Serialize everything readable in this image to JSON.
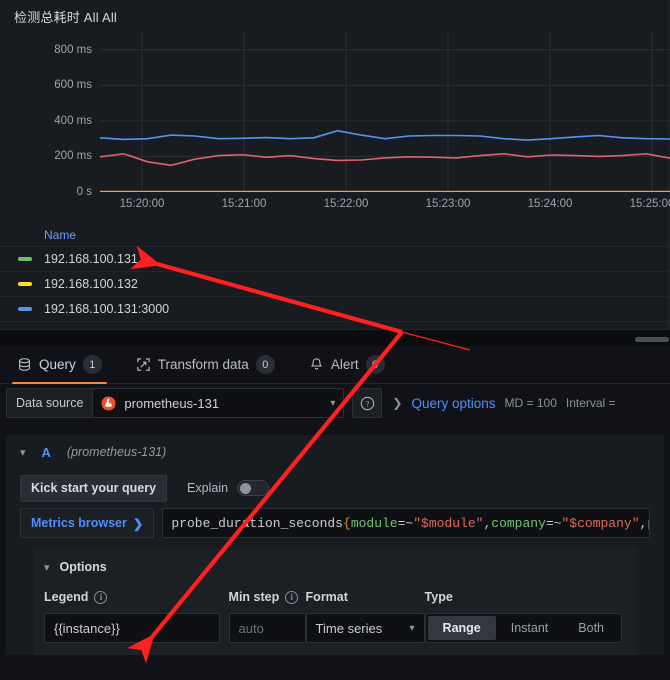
{
  "panel": {
    "title": "检测总耗时 All All",
    "legend_header": "Name",
    "legend": [
      {
        "label": "192.168.100.131",
        "color": "#73BF69"
      },
      {
        "label": "192.168.100.132",
        "color": "#FADE2A"
      },
      {
        "label": "192.168.100.131:3000",
        "color": "#5794F2"
      }
    ]
  },
  "chart_data": {
    "type": "line",
    "title": "检测总耗时 All All",
    "xlabel": "",
    "ylabel": "",
    "grid": true,
    "legend_position": "bottom-table",
    "ytick_labels": [
      "800 ms",
      "600 ms",
      "400 ms",
      "200 ms",
      "0 s"
    ],
    "ytick_values": [
      800,
      600,
      400,
      200,
      0
    ],
    "ylim": [
      0,
      900
    ],
    "xtick_labels": [
      "15:20:00",
      "15:21:00",
      "15:22:00",
      "15:23:00",
      "15:24:00",
      "15:25:00"
    ],
    "x": [
      "15:19:30",
      "15:19:45",
      "15:20:00",
      "15:20:15",
      "15:20:30",
      "15:20:45",
      "15:21:00",
      "15:21:15",
      "15:21:30",
      "15:21:45",
      "15:22:00",
      "15:22:15",
      "15:22:30",
      "15:22:45",
      "15:23:00",
      "15:23:15",
      "15:23:30",
      "15:23:45",
      "15:24:00",
      "15:24:15",
      "15:24:30",
      "15:24:45",
      "15:25:00",
      "15:25:15",
      "15:25:30"
    ],
    "series": [
      {
        "name": "192.168.100.131:3000",
        "color": "#5794F2",
        "unit": "ms",
        "values": [
          305,
          296,
          300,
          320,
          315,
          300,
          302,
          306,
          300,
          305,
          345,
          320,
          300,
          315,
          318,
          318,
          315,
          300,
          292,
          300,
          310,
          318,
          305,
          300,
          298
        ]
      },
      {
        "name": "192.168.100.131",
        "color": "#E0626E",
        "unit": "ms",
        "values": [
          198,
          215,
          170,
          150,
          185,
          205,
          210,
          195,
          205,
          188,
          178,
          180,
          192,
          198,
          196,
          192,
          205,
          215,
          198,
          208,
          205,
          200,
          205,
          215,
          190
        ]
      },
      {
        "name": "192.168.100.132",
        "color": "#FF9830",
        "unit": "ms",
        "values": [
          2,
          2,
          2,
          2,
          2,
          2,
          2,
          2,
          2,
          2,
          2,
          2,
          2,
          2,
          2,
          2,
          2,
          2,
          2,
          2,
          2,
          2,
          2,
          2,
          2
        ]
      }
    ]
  },
  "editor": {
    "tabs": [
      {
        "label": "Query",
        "count": "1",
        "icon": "database-icon",
        "active": true
      },
      {
        "label": "Transform data",
        "count": "0",
        "icon": "transform-icon",
        "active": false
      },
      {
        "label": "Alert",
        "count": "0",
        "icon": "bell-icon",
        "active": false
      }
    ],
    "datasource": {
      "label": "Data source",
      "value": "prometheus-131",
      "icon": "prometheus-icon"
    },
    "query_options": {
      "link": "Query options",
      "max_data_points": "MD = 100",
      "interval": "Interval ="
    },
    "query": {
      "ref_id": "A",
      "datasource_note": "(prometheus-131)",
      "kick_start_label": "Kick start your query",
      "explain_label": "Explain",
      "explain_on": false,
      "metrics_browser_label": "Metrics browser",
      "expr_tokens": [
        {
          "t": "probe_duration_seconds",
          "c": "tok-metric"
        },
        {
          "t": "{",
          "c": "tok-brace"
        },
        {
          "t": "module",
          "c": "tok-label"
        },
        {
          "t": "=~",
          "c": "tok-op"
        },
        {
          "t": "\"$module\"",
          "c": "tok-str"
        },
        {
          "t": ",",
          "c": "tok-comma"
        },
        {
          "t": "company",
          "c": "tok-label"
        },
        {
          "t": "=~",
          "c": "tok-op"
        },
        {
          "t": "\"$company\"",
          "c": "tok-str"
        },
        {
          "t": ",",
          "c": "tok-comma"
        },
        {
          "t": "proj",
          "c": "tok-label"
        }
      ],
      "options": {
        "title": "Options",
        "legend": {
          "label": "Legend",
          "value": "{{instance}}"
        },
        "min_step": {
          "label": "Min step",
          "placeholder": "auto"
        },
        "format": {
          "label": "Format",
          "value": "Time series"
        },
        "type": {
          "label": "Type",
          "items": [
            "Range",
            "Instant",
            "Both"
          ],
          "selected": "Range"
        }
      }
    }
  },
  "annotations": {
    "arrow_color": "#ff2020"
  }
}
